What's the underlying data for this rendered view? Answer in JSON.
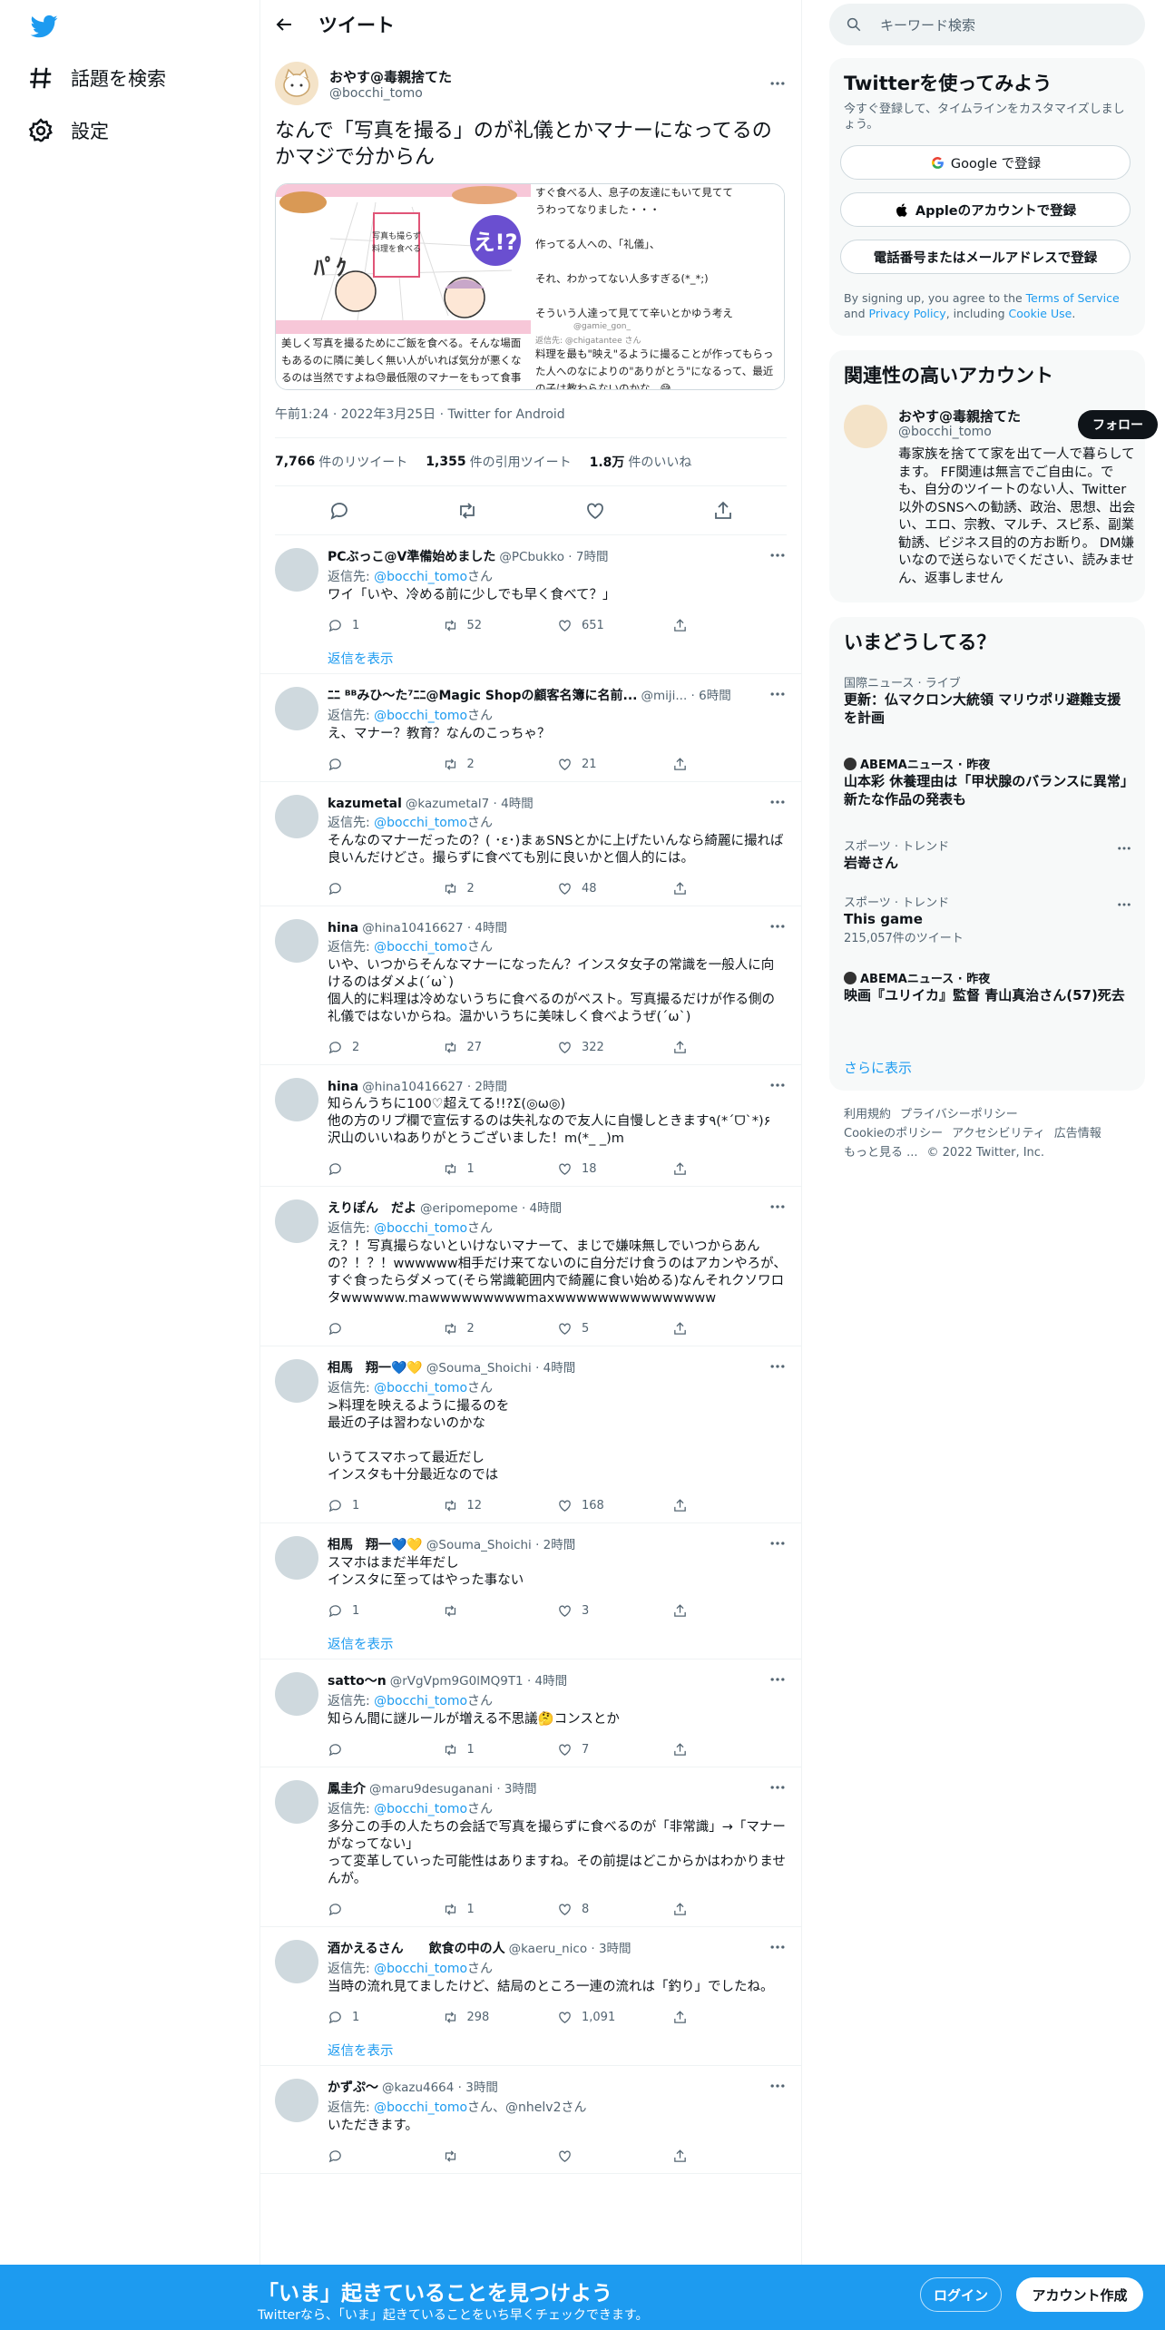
{
  "colors": {
    "accent": "#1d9bf0",
    "text": "#0f1419",
    "muted": "#536471",
    "bottom_bar": "#1d9bf0"
  },
  "nav": {
    "explore": "話題を検索",
    "settings": "設定"
  },
  "header": {
    "title": "ツイート"
  },
  "focal": {
    "name": "おやす@毒親捨てた",
    "handle": "@bocchi_tomo",
    "text": "なんで「写真を撮る」のが礼儀とかマナーになってるのかマジで分からん",
    "image_left_caption": "美しく写真を撮るためにご飯を食べる。そんな場面もあるのに隣に美しく無い人がいれば気分が悪くなるのは当然ですよね😓最低限のマナーをもって食事をすることを教わらなかったんでしょうか...とても悲しいです😥\n教育の現場から見直す必要がありますよ",
    "image_right_text_top": "すぐ食べる人、息子の友達にもいて見てて\nうわってなりました・・・\n\n作ってる人への、「礼儀」、\n\nそれ、わかってない人多すぎる(*_*;)\n\nそういう人達って見てて辛いとかゆう考え",
    "image_right_handle": "@gamie_gon_",
    "image_right_replyto": "返信先: @chigatantee さん",
    "image_right_text_bottom": "料理を最も\"映え\"るように撮ることが作ってもらった人へのなによりの\"ありがとう\"になるって、最近の子は教わらないのかな...😅\nどうして日本はこんなにも余裕のない国になっちゃったんだろ。😓",
    "timestamp": "午前1:24 · 2022年3月25日 · Twitter for Android",
    "stats": [
      {
        "num": "7,766",
        "label": "件のリツイート"
      },
      {
        "num": "1,355",
        "label": "件の引用ツイート"
      },
      {
        "num": "1.8万",
        "label": "件のいいね"
      }
    ]
  },
  "replies": [
    {
      "name": "PCぶっこ@V準備始めました",
      "handle": "@PCbukko · 7時間",
      "replyto_prefix": "返信先: ",
      "replyto_user": "@bocchi_tomo",
      "replyto_suffix": "さん",
      "text": "ワイ「いや、冷める前に少しでも早く食べて？」",
      "counts": {
        "reply": "1",
        "rt": "52",
        "like": "651"
      },
      "show_thread": "返信を表示"
    },
    {
      "name": "ﾆﾆ ᴮᴮみひ〜た⁷ﾆﾆ@Magic Shopの顧客名簿に名前...",
      "handle": "@miji... · 6時間",
      "replyto_prefix": "返信先: ",
      "replyto_user": "@bocchi_tomo",
      "replyto_suffix": "さん",
      "text": "え、マナー？教育？なんのこっちゃ？",
      "counts": {
        "reply": "",
        "rt": "2",
        "like": "21"
      }
    },
    {
      "name": "kazumetal",
      "handle": "@kazumetal7 · 4時間",
      "replyto_prefix": "返信先: ",
      "replyto_user": "@bocchi_tomo",
      "replyto_suffix": "さん",
      "text": "そんなのマナーだったの？( ･ε･)まぁSNSとかに上げたいんなら綺麗に撮れば良いんだけどさ。撮らずに食べても別に良いかと個人的には。",
      "counts": {
        "reply": "",
        "rt": "2",
        "like": "48"
      }
    },
    {
      "name": "hina",
      "handle": "@hina10416627 · 4時間",
      "replyto_prefix": "返信先: ",
      "replyto_user": "@bocchi_tomo",
      "replyto_suffix": "さん",
      "text": "いや、いつからそんなマナーになったん？インスタ女子の常識を一般人に向けるのはダメよ(ˊωˋ)\n個人的に料理は冷めないうちに食べるのがベスト。写真撮るだけが作る側の礼儀ではないからね。温かいうちに美味しく食べようぜ(ˊωˋ)",
      "counts": {
        "reply": "2",
        "rt": "27",
        "like": "322"
      }
    },
    {
      "name": "hina",
      "handle": "@hina10416627 · 2時間",
      "text": "知らんうちに100♡超えてる!!?Σ(◎ω◎)\n他の方のリプ欄で宣伝するのは失礼なので友人に自慢しときます٩(*ˊᗜˋ*)۶\n沢山のいいねありがとうございました！m(*_ _)m",
      "counts": {
        "reply": "",
        "rt": "1",
        "like": "18"
      }
    },
    {
      "name": "えりぽん　だよ",
      "handle": "@eripomepome · 4時間",
      "replyto_prefix": "返信先: ",
      "replyto_user": "@bocchi_tomo",
      "replyto_suffix": "さん",
      "text": "え？！写真撮らないといけないマナーて、まじで嫌味無しでいつからあんの？！？！wwwwww相手だけ来てないのに自分だけ食うのはアカンやろが、すぐ食ったらダメって(そら常識範囲内で綺麗に食い始める)なんそれクソワロタwwwwww.mawwwwwwwwwmaxwwwwwwwwwwwwwww",
      "counts": {
        "reply": "",
        "rt": "2",
        "like": "5"
      }
    },
    {
      "name": "相馬　翔一💙💛",
      "handle": "@Souma_Shoichi · 4時間",
      "replyto_prefix": "返信先: ",
      "replyto_user": "@bocchi_tomo",
      "replyto_suffix": "さん",
      "text": ">料理を映えるように撮るのを\n最近の子は習わないのかな\n\nいうてスマホって最近だし\nインスタも十分最近なのでは",
      "counts": {
        "reply": "1",
        "rt": "12",
        "like": "168"
      }
    },
    {
      "name": "相馬　翔一💙💛",
      "handle": "@Souma_Shoichi · 2時間",
      "text": "スマホはまだ半年だし\nインスタに至ってはやった事ない",
      "counts": {
        "reply": "1",
        "rt": "",
        "like": "3"
      },
      "show_thread": "返信を表示"
    },
    {
      "name": "satto〜n",
      "handle": "@rVgVpm9G0lMQ9T1 · 4時間",
      "replyto_prefix": "返信先: ",
      "replyto_user": "@bocchi_tomo",
      "replyto_suffix": "さん",
      "text": "知らん間に謎ルールが増える不思議🤔コンスとか",
      "counts": {
        "reply": "",
        "rt": "1",
        "like": "7"
      }
    },
    {
      "name": "鳳圭介",
      "handle": "@maru9desuganani · 3時間",
      "replyto_prefix": "返信先: ",
      "replyto_user": "@bocchi_tomo",
      "replyto_suffix": "さん",
      "text": "多分この手の人たちの会話で写真を撮らずに食べるのが「非常識」→「マナーがなってない」\nって変革していった可能性はありますね。その前提はどこからかはわかりませんが。",
      "counts": {
        "reply": "",
        "rt": "1",
        "like": "8"
      }
    },
    {
      "name": "酒かえるさん　　飲食の中の人",
      "handle": "@kaeru_nico · 3時間",
      "replyto_prefix": "返信先: ",
      "replyto_user": "@bocchi_tomo",
      "replyto_suffix": "さん",
      "text": "当時の流れ見てましたけど、結局のところ一連の流れは「釣り」でしたね。",
      "counts": {
        "reply": "1",
        "rt": "298",
        "like": "1,091"
      },
      "show_thread": "返信を表示"
    },
    {
      "name": "かずぷ〜",
      "handle": "@kazu4664 · 3時間",
      "replyto_prefix": "返信先: ",
      "replyto_user": "@bocchi_tomo",
      "replyto_suffix": "さん、@nhelv2さん",
      "text": "いただきます。",
      "counts": {
        "reply": "",
        "rt": "",
        "like": ""
      }
    }
  ],
  "right": {
    "search_placeholder": "キーワード検索",
    "signup": {
      "title": "Twitterを使ってみよう",
      "subtitle": "今すぐ登録して、タイムラインをカスタマイズしましょう。",
      "google": "Google で登録",
      "apple": "Appleのアカウントで登録",
      "phone": "電話番号またはメールアドレスで登録",
      "terms_1": "By signing up, you agree to the ",
      "terms_link1": "Terms of Service",
      "terms_2": " and ",
      "terms_link2": "Privacy Policy",
      "terms_3": ", including ",
      "terms_link3": "Cookie Use",
      "terms_4": "."
    },
    "related": {
      "title": "関連性の高いアカウント",
      "name": "おやす@毒親捨てた",
      "handle": "@bocchi_tomo",
      "follow": "フォロー",
      "bio": "毒家族を捨てて家を出て一人で暮らしてます。 FF関連は無言でご自由に。でも、自分のツイートのない人、Twitter以外のSNSへの勧誘、政治、思想、出会い、エロ、宗教、マルチ、スピ系、副業勧誘、ビジネス目的の方お断り。 DM嫌いなので送らないでください、読みません、返事しません"
    },
    "trends": {
      "title": "いまどうしてる？",
      "items": [
        {
          "ctx": "国際ニュース · ライブ",
          "title": "更新：仏マクロン大統領 マリウポリ避難支援を計画"
        },
        {
          "ctx": "ABEMAニュース · 昨夜",
          "title": "山本彩 休養理由は「甲状腺のバランスに異常」新たな作品の発表も"
        },
        {
          "ctx": "スポーツ · トレンド",
          "title": "岩嵜さん"
        },
        {
          "ctx": "スポーツ · トレンド",
          "title": "This game",
          "count": "215,057件のツイート"
        },
        {
          "ctx": "ABEMAニュース · 昨夜",
          "title": "映画『ユリイカ』監督 青山真治さん(57)死去"
        }
      ],
      "more": "さらに表示"
    },
    "footer": {
      "l1": "利用規約",
      "l2": "プライバシーポリシー",
      "l3": "Cookieのポリシー",
      "l4": "アクセシビリティ",
      "l5": "広告情報",
      "l6": "もっと見る ...",
      "l7": "© 2022 Twitter, Inc."
    }
  },
  "bottom": {
    "title": "「いま」起きていることを見つけよう",
    "subtitle": "Twitterなら、「いま」起きていることをいち早くチェックできます。",
    "login": "ログイン",
    "signup": "アカウント作成"
  }
}
